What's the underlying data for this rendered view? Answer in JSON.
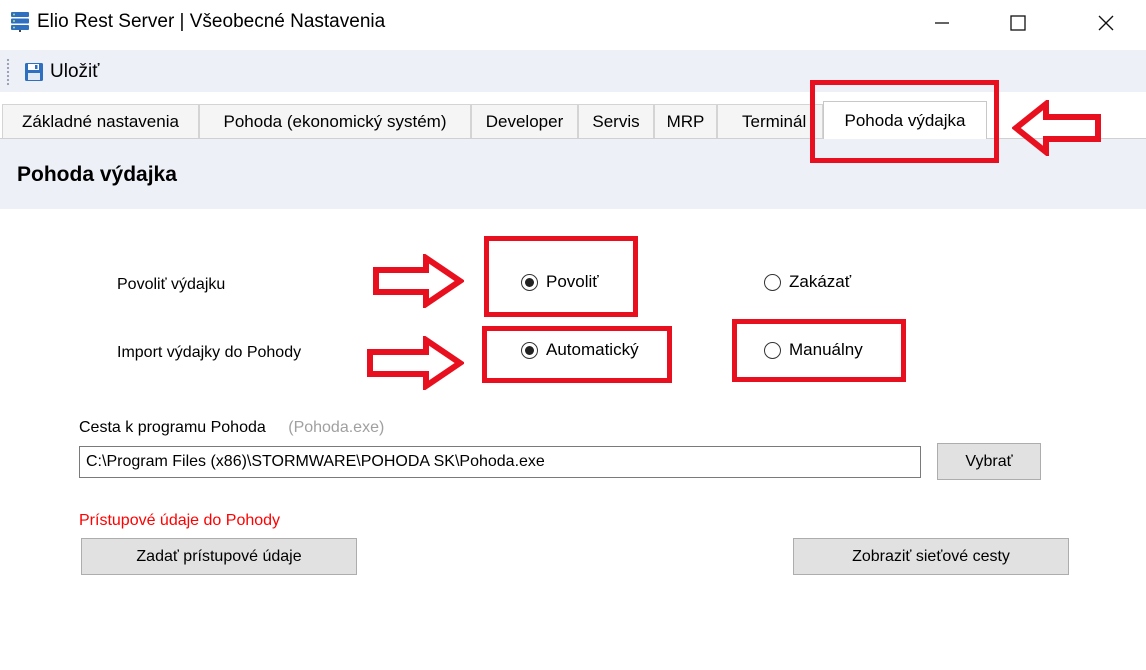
{
  "window": {
    "title": "Elio Rest Server | Všeobecné Nastavenia",
    "minimize": "—",
    "maximize": "☐",
    "close": "✕"
  },
  "toolbar": {
    "save_label": "Uložiť",
    "save_icon": "floppy-disk-icon"
  },
  "tabs": [
    {
      "label": "Základné nastavenia"
    },
    {
      "label": "Pohoda (ekonomický systém)"
    },
    {
      "label": "Developer"
    },
    {
      "label": "Servis"
    },
    {
      "label": "MRP"
    },
    {
      "label": "Terminál"
    },
    {
      "label": "Pohoda výdajka",
      "active": true
    }
  ],
  "panel": {
    "title": "Pohoda výdajka",
    "enable_row": {
      "label": "Povoliť výdajku",
      "options": [
        {
          "label": "Povoliť",
          "checked": true
        },
        {
          "label": "Zakázať",
          "checked": false
        }
      ]
    },
    "import_row": {
      "label": "Import výdajky do Pohody",
      "options": [
        {
          "label": "Automatický",
          "checked": true
        },
        {
          "label": "Manuálny",
          "checked": false
        }
      ]
    },
    "path": {
      "label": "Cesta k programu Pohoda",
      "hint": "(Pohoda.exe)",
      "value": "C:\\Program Files (x86)\\STORMWARE\\POHODA SK\\Pohoda.exe",
      "browse_label": "Vybrať"
    },
    "credentials": {
      "label": "Prístupové údaje do Pohody",
      "button_label": "Zadať prístupové údaje"
    },
    "network_paths_button": "Zobraziť sieťové cesty"
  },
  "colors": {
    "accent_red": "#e8101f",
    "header_bg": "#eef0f8",
    "credentials_label": "#ff0000",
    "hint_gray": "#a0a0a0"
  }
}
